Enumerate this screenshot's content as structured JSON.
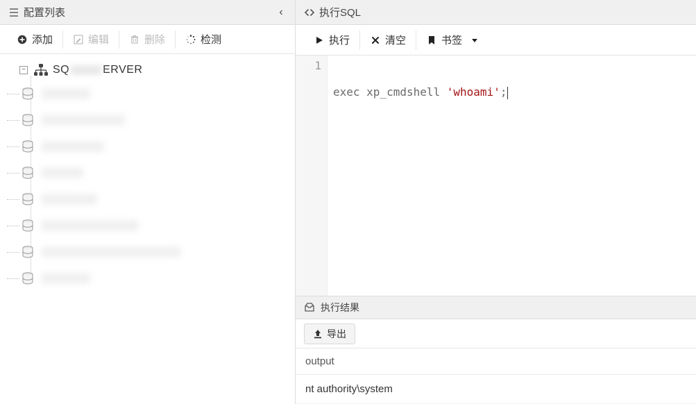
{
  "left": {
    "title": "配置列表",
    "toolbar": {
      "add": "添加",
      "edit": "编辑",
      "delete": "删除",
      "test": "检测"
    },
    "tree": {
      "server_prefix": "SQ",
      "server_suffix": "ERVER",
      "db_count": 8
    }
  },
  "right": {
    "title": "执行SQL",
    "toolbar": {
      "run": "执行",
      "clear": "清空",
      "bookmark": "书签"
    },
    "editor": {
      "lines": [
        "1"
      ],
      "code": {
        "kw": "exec",
        "ident": " xp_cmdshell ",
        "str": "'whoami'",
        "tail": ";"
      }
    },
    "result": {
      "title": "执行结果",
      "export": "导出",
      "header": "output",
      "rows": [
        "nt authority\\system"
      ]
    }
  }
}
